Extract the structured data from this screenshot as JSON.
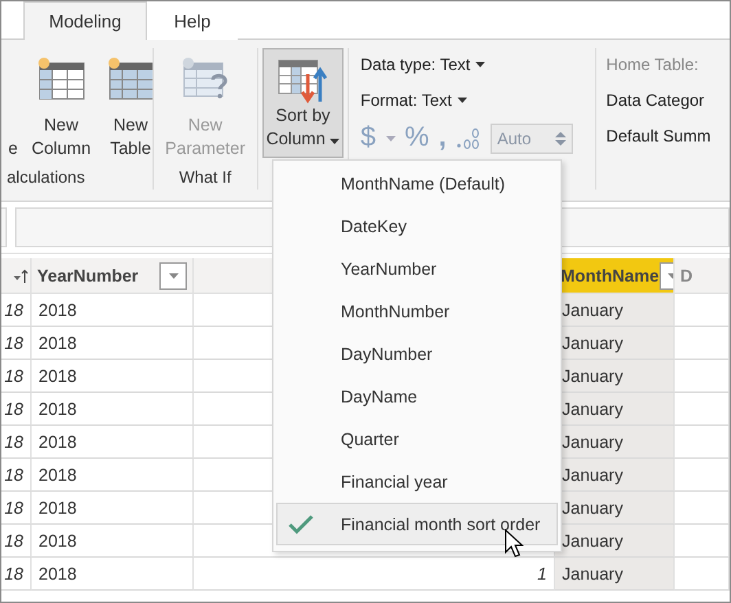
{
  "tabs": [
    {
      "label": "Modeling",
      "selected": true
    },
    {
      "label": "Help",
      "selected": false
    }
  ],
  "calculations": {
    "label": "alculations",
    "buttons": [
      {
        "lines": [
          "e"
        ],
        "disabled": false
      },
      {
        "lines": [
          "New",
          "Column"
        ],
        "disabled": false
      },
      {
        "lines": [
          "New",
          "Table"
        ],
        "disabled": false
      }
    ]
  },
  "what_if": {
    "label": "What If",
    "buttons": [
      {
        "lines": [
          "New",
          "Parameter"
        ],
        "disabled": true
      }
    ]
  },
  "sort": {
    "lines": [
      "Sort by",
      "Column"
    ],
    "pressed": true
  },
  "formatting": {
    "data_type": "Data type: Text",
    "format": "Format: Text",
    "currency": "$",
    "percent": "%",
    "comma": ",",
    "auto": "Auto"
  },
  "properties": [
    {
      "label": "Home Table:",
      "disabled": true
    },
    {
      "label": "Data Categor",
      "disabled": false
    },
    {
      "label": "Default Summ",
      "disabled": false
    }
  ],
  "table": {
    "columns": [
      {
        "label": "YearNumber",
        "selected": false
      },
      {
        "label": "MonthName",
        "selected": true
      },
      {
        "label": "D",
        "selected": false
      }
    ],
    "rows": [
      {
        "column_1": "18",
        "year": "2018",
        "month": "January"
      },
      {
        "column_1": "18",
        "year": "2018",
        "month": "January"
      },
      {
        "column_1": "18",
        "year": "2018",
        "month": "January"
      },
      {
        "column_1": "18",
        "year": "2018",
        "month": "January"
      },
      {
        "column_1": "18",
        "year": "2018",
        "month": "January"
      },
      {
        "column_1": "18",
        "year": "2018",
        "month": "January"
      },
      {
        "column_1": "18",
        "year": "2018",
        "month": "January"
      },
      {
        "column_1": "18",
        "year": "2018",
        "month": "January"
      },
      {
        "column_1": "18",
        "year": "2018",
        "month": "January",
        "column_3": "1"
      }
    ]
  },
  "sort_menu": [
    {
      "label": "MonthName (Default)",
      "selected": false
    },
    {
      "label": "DateKey",
      "selected": false
    },
    {
      "label": "YearNumber",
      "selected": false
    },
    {
      "label": "MonthNumber",
      "selected": false
    },
    {
      "label": "DayNumber",
      "selected": false
    },
    {
      "label": "DayName",
      "selected": false
    },
    {
      "label": "Quarter",
      "selected": false
    },
    {
      "label": "Financial year",
      "selected": false
    },
    {
      "label": "Financial month sort order",
      "selected": true
    }
  ]
}
